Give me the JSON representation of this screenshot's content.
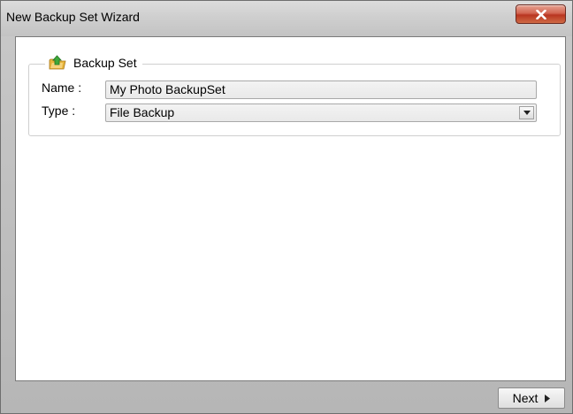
{
  "window": {
    "title": "New Backup Set Wizard"
  },
  "backup_set_group": {
    "title": "Backup Set",
    "icon": "folder-arrow-icon",
    "name_label": "Name :",
    "name_value": "My Photo BackupSet",
    "type_label": "Type :",
    "type_value": "File Backup"
  },
  "footer": {
    "next_label": "Next"
  },
  "colors": {
    "close_button": "#c74a36",
    "window_chrome": "#c3c3c3",
    "folder_icon": "#e8b53a",
    "arrow_icon": "#3ea83a"
  }
}
